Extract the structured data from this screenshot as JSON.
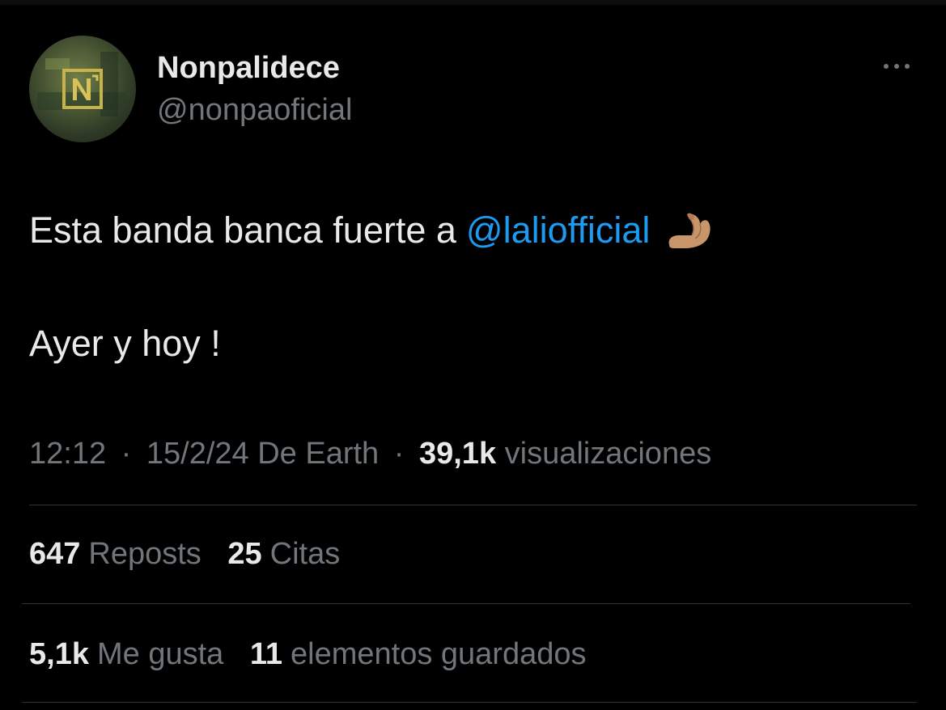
{
  "author": {
    "display_name": "Nonpalidece",
    "handle": "@nonpaoficial"
  },
  "tweet": {
    "text_before_mention": "Esta banda banca fuerte a",
    "mention": "@laliofficial",
    "emoji": "flexed-biceps",
    "line2": "Ayer y hoy !"
  },
  "meta": {
    "time": "12:12",
    "date": "15/2/24",
    "source": "De Earth",
    "separator": "·",
    "views_count": "39,1k",
    "views_label": "visualizaciones"
  },
  "stats": {
    "reposts": {
      "count": "647",
      "label": "Reposts"
    },
    "quotes": {
      "count": "25",
      "label": "Citas"
    },
    "likes": {
      "count": "5,1k",
      "label": "Me gusta"
    },
    "bookmarks": {
      "count": "11",
      "label": "elementos guardados"
    }
  },
  "colors": {
    "background": "#000000",
    "text_primary": "#e7e9ea",
    "text_secondary": "#71767b",
    "link": "#1d9bf0",
    "divider": "#2f3336"
  },
  "icons": {
    "more": "more-horizontal-icon",
    "emoji": "flexed-biceps-emoji"
  }
}
